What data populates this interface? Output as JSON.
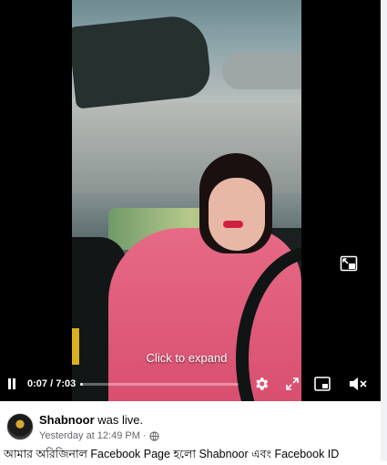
{
  "video": {
    "click_to_expand": "Click to expand",
    "current_time": "0:07",
    "duration": "7:03",
    "time_separator": " / ",
    "progress_fraction": 0.017
  },
  "controls": {
    "pause_icon": "pause-icon",
    "settings_icon": "gear-icon",
    "fullscreen_icon": "expand-arrows-icon",
    "pip_icon": "picture-in-picture-icon",
    "mute_icon": "speaker-muted-icon",
    "exit_pip_icon": "exit-pip-icon"
  },
  "post": {
    "author": "Shabnoor",
    "author_action": "was live.",
    "timestamp": "Yesterday at 12:49 PM",
    "dot": "·",
    "privacy_icon": "globe-icon",
    "caption": "আমার অরিজিনাল Facebook Page হলো Shabnoor এবং Facebook ID"
  },
  "colors": {
    "video_bg": "#000000",
    "meta_text": "#65676b",
    "jacket_pink": "#e0607e"
  }
}
